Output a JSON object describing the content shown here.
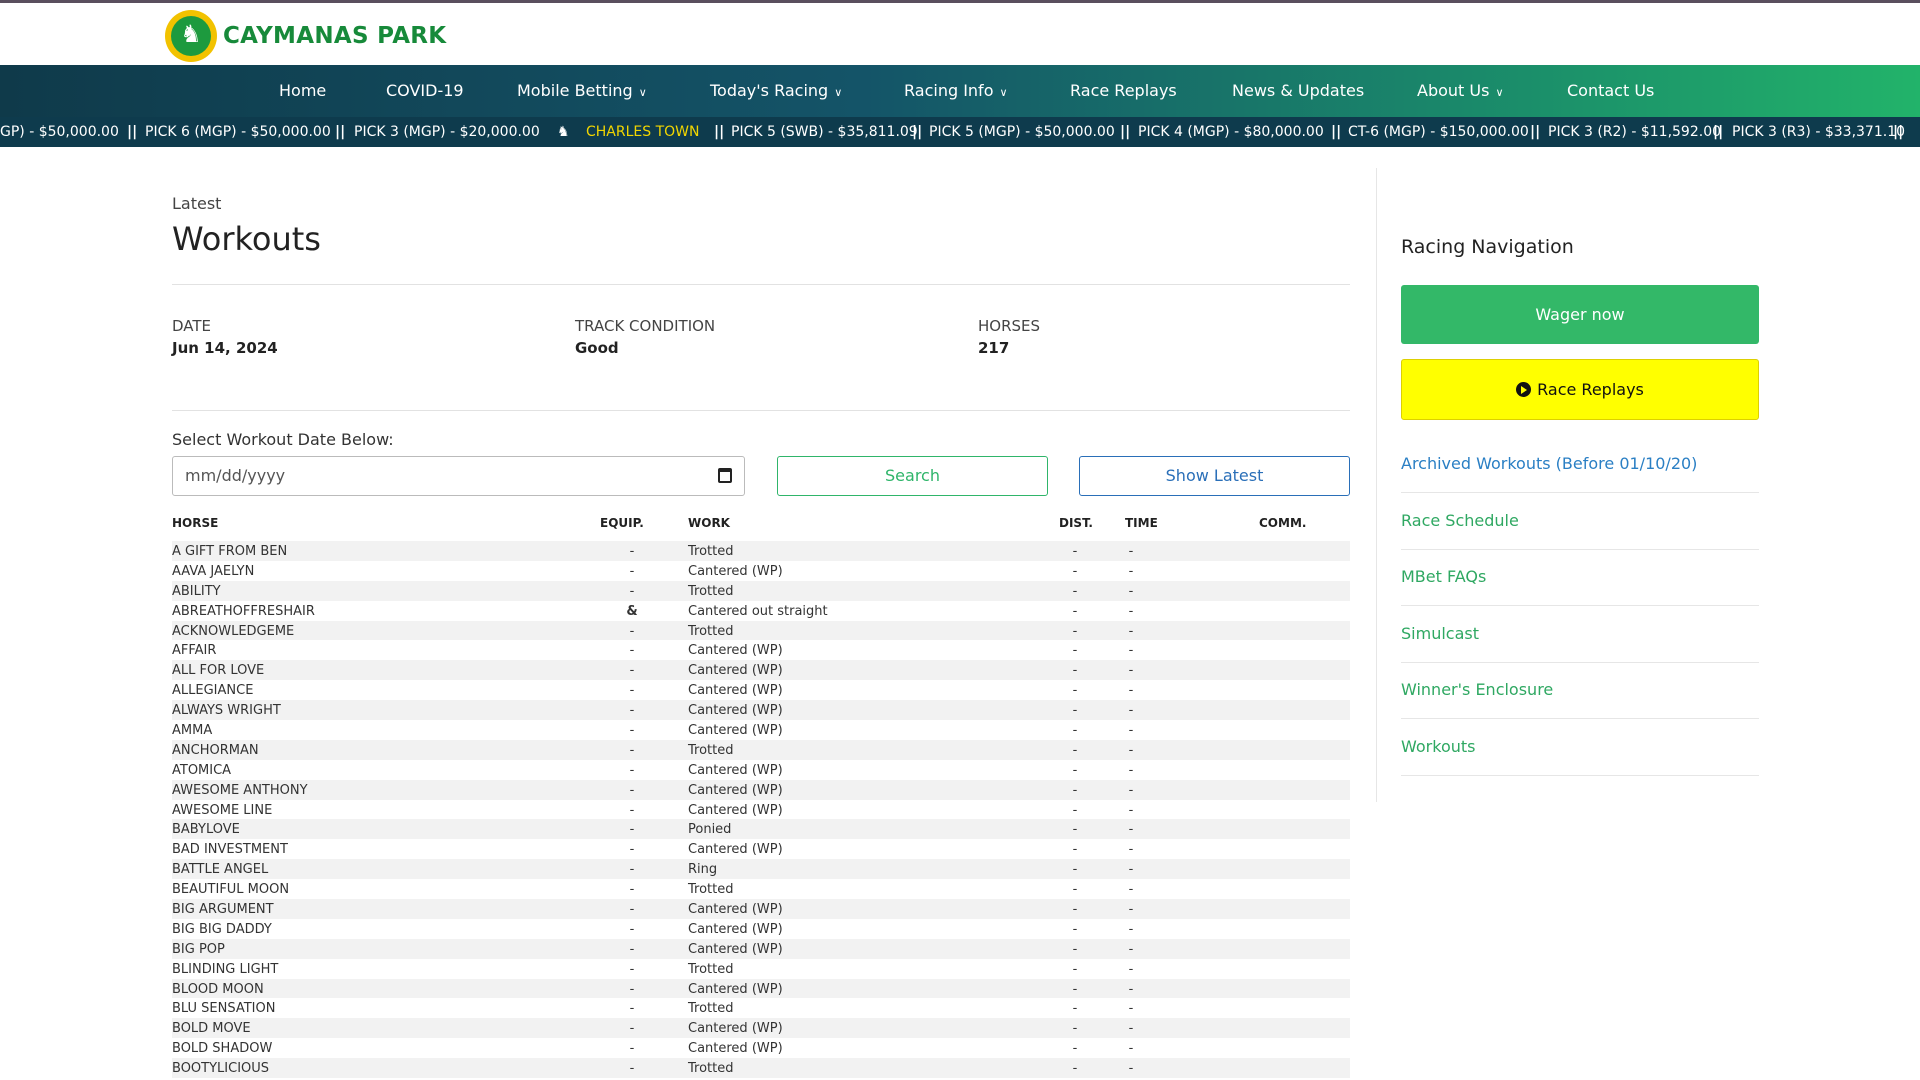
{
  "brand": {
    "name": "CAYMANAS PARK",
    "primary": "#178a3a",
    "accent": "#33b868",
    "nav_bg": "#0f3a4a"
  },
  "nav": {
    "items": [
      {
        "label": "Home",
        "dropdown": false
      },
      {
        "label": "COVID-19",
        "dropdown": false
      },
      {
        "label": "Mobile Betting",
        "dropdown": true
      },
      {
        "label": "Today's Racing",
        "dropdown": true
      },
      {
        "label": "Racing Info",
        "dropdown": true
      },
      {
        "label": "Race Replays",
        "dropdown": false
      },
      {
        "label": "News & Updates",
        "dropdown": false
      },
      {
        "label": "About Us",
        "dropdown": true
      },
      {
        "label": "Contact Us",
        "dropdown": false
      }
    ]
  },
  "ticker": {
    "items": [
      "GP) - $50,000.00",
      "PICK 6 (MGP) - $50,000.00",
      "PICK 3 (MGP) - $20,000.00",
      "CHARLES TOWN",
      "PICK 5 (SWB) - $35,811.09",
      "PICK 5 (MGP) - $50,000.00",
      "PICK 4 (MGP) - $80,000.00",
      "CT-6 (MGP) - $150,000.00",
      "PICK 3 (R2) - $11,592.00",
      "PICK 3 (R3) - $33,371.10"
    ],
    "separator": "||"
  },
  "page": {
    "eyebrow": "Latest",
    "title": "Workouts"
  },
  "meta": {
    "date_label": "DATE",
    "date_value": "Jun 14, 2024",
    "track_label": "TRACK CONDITION",
    "track_value": "Good",
    "horses_label": "HORSES",
    "horses_value": "217"
  },
  "filter": {
    "label": "Select Workout Date Below:",
    "date_placeholder": "mm/dd/yyyy",
    "search_label": "Search",
    "latest_label": "Show Latest"
  },
  "table": {
    "headers": {
      "horse": "HORSE",
      "equip": "EQUIP.",
      "work": "WORK",
      "dist": "DIST.",
      "time": "TIME",
      "comm": "COMM."
    },
    "rows": [
      [
        "A GIFT FROM BEN",
        "-",
        "Trotted",
        "-",
        "-"
      ],
      [
        "AAVA JAELYN",
        "-",
        "Cantered (WP)",
        "-",
        "-"
      ],
      [
        "ABILITY",
        "-",
        "Trotted",
        "-",
        "-"
      ],
      [
        "ABREATHOFFRESHAIR",
        "&",
        "Cantered out straight",
        "-",
        "-"
      ],
      [
        "ACKNOWLEDGEME",
        "-",
        "Trotted",
        "-",
        "-"
      ],
      [
        "AFFAIR",
        "-",
        "Cantered (WP)",
        "-",
        "-"
      ],
      [
        "ALL FOR LOVE",
        "-",
        "Cantered (WP)",
        "-",
        "-"
      ],
      [
        "ALLEGIANCE",
        "-",
        "Cantered (WP)",
        "-",
        "-"
      ],
      [
        "ALWAYS WRIGHT",
        "-",
        "Cantered (WP)",
        "-",
        "-"
      ],
      [
        "AMMA",
        "-",
        "Cantered (WP)",
        "-",
        "-"
      ],
      [
        "ANCHORMAN",
        "-",
        "Trotted",
        "-",
        "-"
      ],
      [
        "ATOMICA",
        "-",
        "Cantered (WP)",
        "-",
        "-"
      ],
      [
        "AWESOME ANTHONY",
        "-",
        "Cantered (WP)",
        "-",
        "-"
      ],
      [
        "AWESOME LINE",
        "-",
        "Cantered (WP)",
        "-",
        "-"
      ],
      [
        "BABYLOVE",
        "-",
        "Ponied",
        "-",
        "-"
      ],
      [
        "BAD INVESTMENT",
        "-",
        "Cantered (WP)",
        "-",
        "-"
      ],
      [
        "BATTLE ANGEL",
        "-",
        "Ring",
        "-",
        "-"
      ],
      [
        "BEAUTIFUL MOON",
        "-",
        "Trotted",
        "-",
        "-"
      ],
      [
        "BIG ARGUMENT",
        "-",
        "Cantered (WP)",
        "-",
        "-"
      ],
      [
        "BIG BIG DADDY",
        "-",
        "Cantered (WP)",
        "-",
        "-"
      ],
      [
        "BIG POP",
        "-",
        "Cantered (WP)",
        "-",
        "-"
      ],
      [
        "BLINDING LIGHT",
        "-",
        "Trotted",
        "-",
        "-"
      ],
      [
        "BLOOD MOON",
        "-",
        "Cantered (WP)",
        "-",
        "-"
      ],
      [
        "BLU SENSATION",
        "-",
        "Trotted",
        "-",
        "-"
      ],
      [
        "BOLD MOVE",
        "-",
        "Cantered (WP)",
        "-",
        "-"
      ],
      [
        "BOLD SHADOW",
        "-",
        "Cantered (WP)",
        "-",
        "-"
      ],
      [
        "BOOTYLICIOUS",
        "-",
        "Trotted",
        "-",
        "-"
      ]
    ]
  },
  "sidebar": {
    "title": "Racing Navigation",
    "wager_label": "Wager now",
    "replays_label": "Race Replays",
    "links": [
      {
        "label": "Archived Workouts (Before 01/10/20)",
        "color": "#2a7fc4"
      },
      {
        "label": "Race Schedule",
        "color": "#2fa862"
      },
      {
        "label": "MBet FAQs",
        "color": "#2fa862"
      },
      {
        "label": "Simulcast",
        "color": "#2fa862"
      },
      {
        "label": "Winner's Enclosure",
        "color": "#2fa862"
      },
      {
        "label": "Workouts",
        "color": "#2fa862"
      }
    ]
  }
}
